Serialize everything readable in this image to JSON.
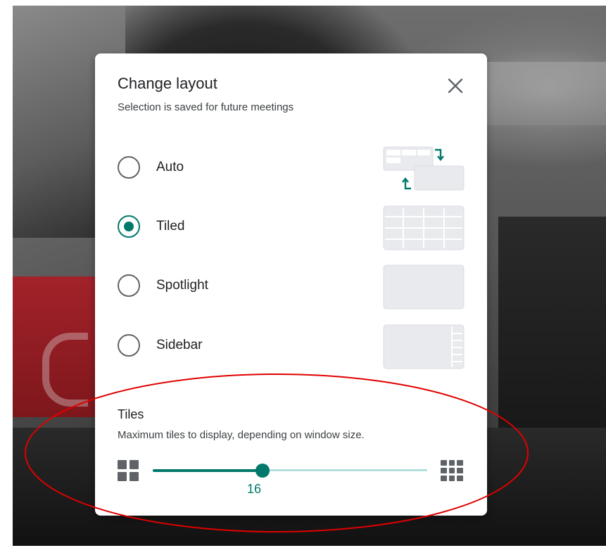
{
  "dialog": {
    "title": "Change layout",
    "subtitle": "Selection is saved for future meetings",
    "close_icon": "close-icon"
  },
  "options": [
    {
      "label": "Auto",
      "selected": false,
      "thumbnail": "auto-layout-icon"
    },
    {
      "label": "Tiled",
      "selected": true,
      "thumbnail": "tiled-layout-icon"
    },
    {
      "label": "Spotlight",
      "selected": false,
      "thumbnail": "spotlight-layout-icon"
    },
    {
      "label": "Sidebar",
      "selected": false,
      "thumbnail": "sidebar-layout-icon"
    }
  ],
  "tiles": {
    "title": "Tiles",
    "description": "Maximum tiles to display, depending on window size.",
    "value": "16",
    "slider_fraction": 0.4,
    "min_icon": "few-tiles-icon",
    "max_icon": "many-tiles-icon"
  },
  "colors": {
    "accent": "#00796b",
    "track_inactive": "#b2dfdb",
    "annotation": "#e00000"
  }
}
